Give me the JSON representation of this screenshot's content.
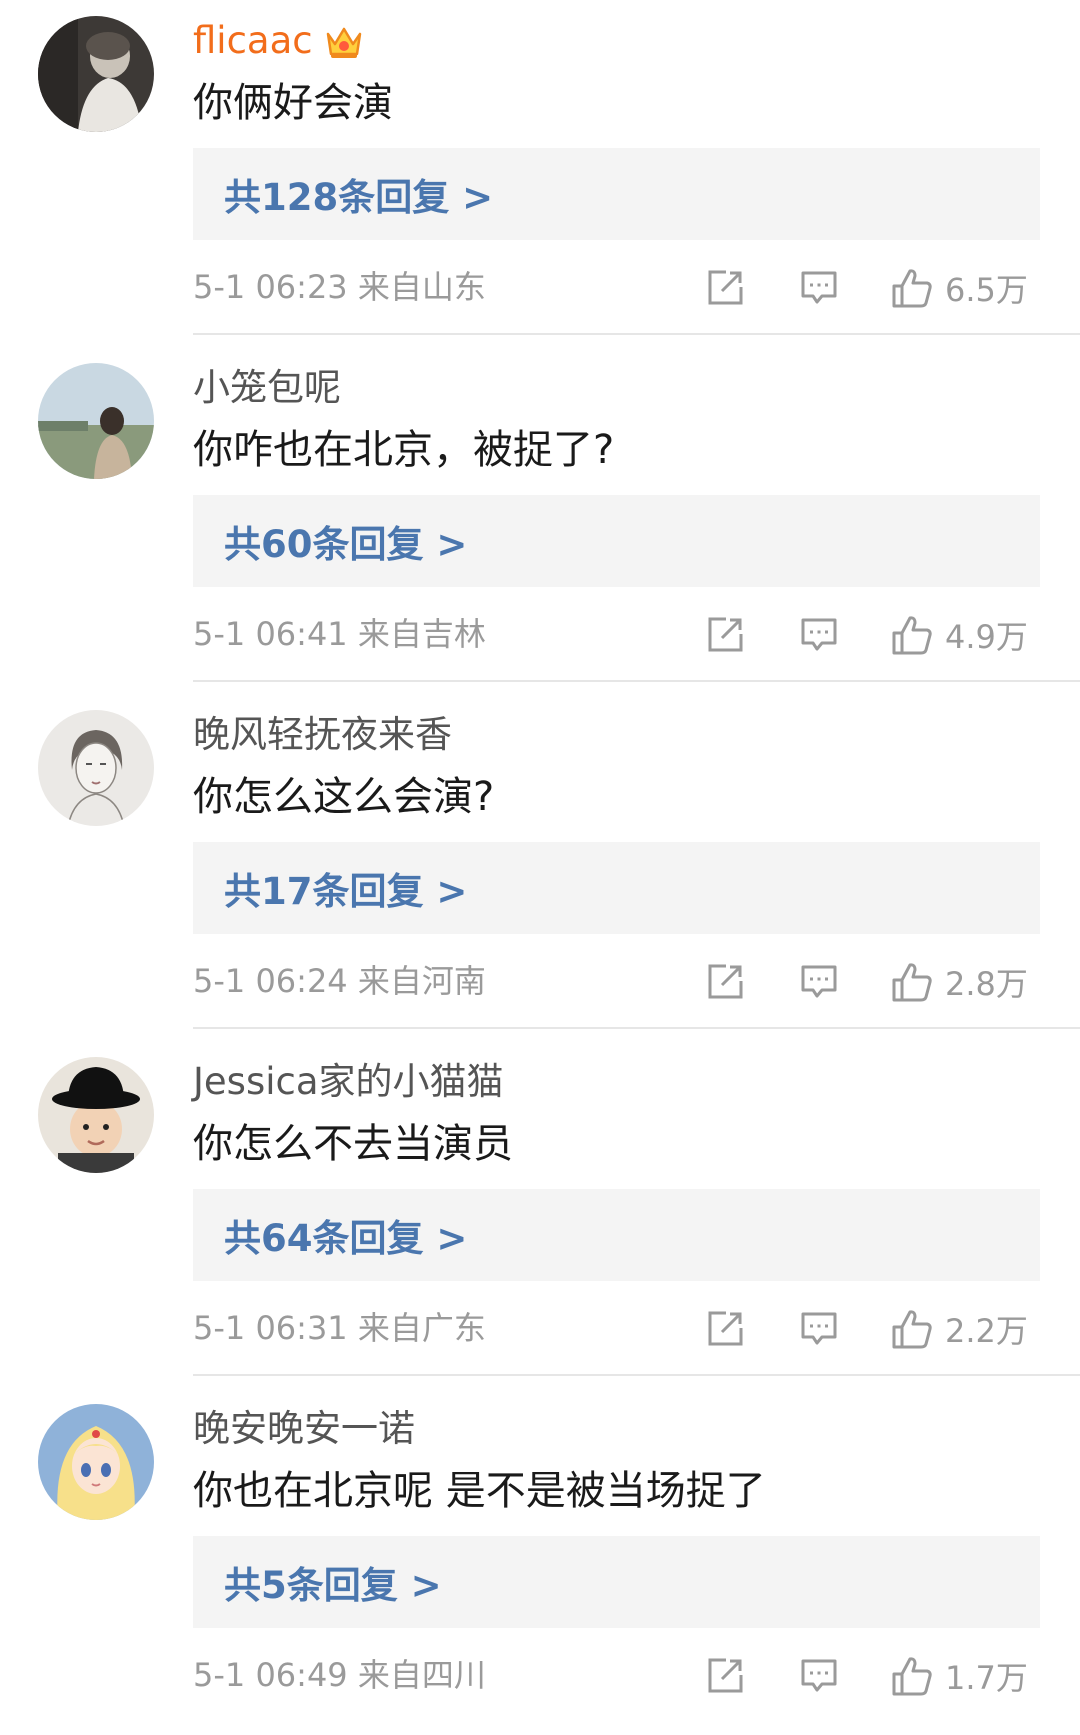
{
  "comments": [
    {
      "user": "flicaac",
      "text": "你俩好会演",
      "replies": "共128条回复 >",
      "time": "5-1 06:23",
      "location": "来自山东",
      "likes": "6.5万",
      "vip": true
    },
    {
      "user": "小笼包呢",
      "text": "你咋也在北京，被捉了?",
      "replies": "共60条回复 >",
      "time": "5-1 06:41",
      "location": "来自吉林",
      "likes": "4.9万"
    },
    {
      "user": "晚风轻抚夜来香",
      "text": "你怎么这么会演?",
      "replies": "共17条回复 >",
      "time": "5-1 06:24",
      "location": "来自河南",
      "likes": "2.8万"
    },
    {
      "user": "Jessica家的小猫猫",
      "text": "你怎么不去当演员",
      "replies": "共64条回复 >",
      "time": "5-1 06:31",
      "location": "来自广东",
      "likes": "2.2万"
    },
    {
      "user": "晚安晚安一诺",
      "text": "你也在北京呢 是不是被当场捉了",
      "replies": "共5条回复 >",
      "time": "5-1 06:49",
      "location": "来自四川",
      "likes": "1.7万"
    }
  ],
  "icons": {
    "share": "share-icon",
    "comment": "comment-icon",
    "like": "thumbs-up-icon",
    "vip": "crown-icon"
  },
  "colors": {
    "vip_username": "#f26d1b",
    "reply_link": "#4a76ae",
    "reply_box_bg": "#f4f4f4"
  }
}
